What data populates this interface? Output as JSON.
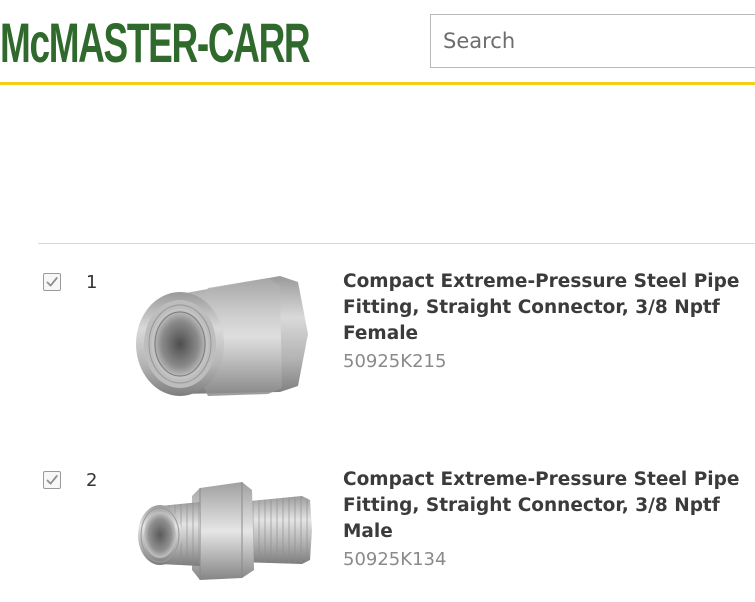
{
  "header": {
    "logo_text": "McMASTER-CARR",
    "logo_color": "#2f6a2c",
    "accent_rule_color": "#f1cf1c",
    "search": {
      "placeholder": "Search",
      "value": ""
    }
  },
  "items": [
    {
      "checked": true,
      "index": "1",
      "title": "Compact Extreme-Pressure Steel Pipe Fitting, Straight Connector, 3/8 Nptf Female",
      "part_number": "50925K215",
      "image": "steel-female-coupling"
    },
    {
      "checked": true,
      "index": "2",
      "title": "Compact Extreme-Pressure Steel Pipe Fitting, Straight Connector, 3/8 Nptf Male",
      "part_number": "50925K134",
      "image": "steel-hex-nipple"
    }
  ]
}
